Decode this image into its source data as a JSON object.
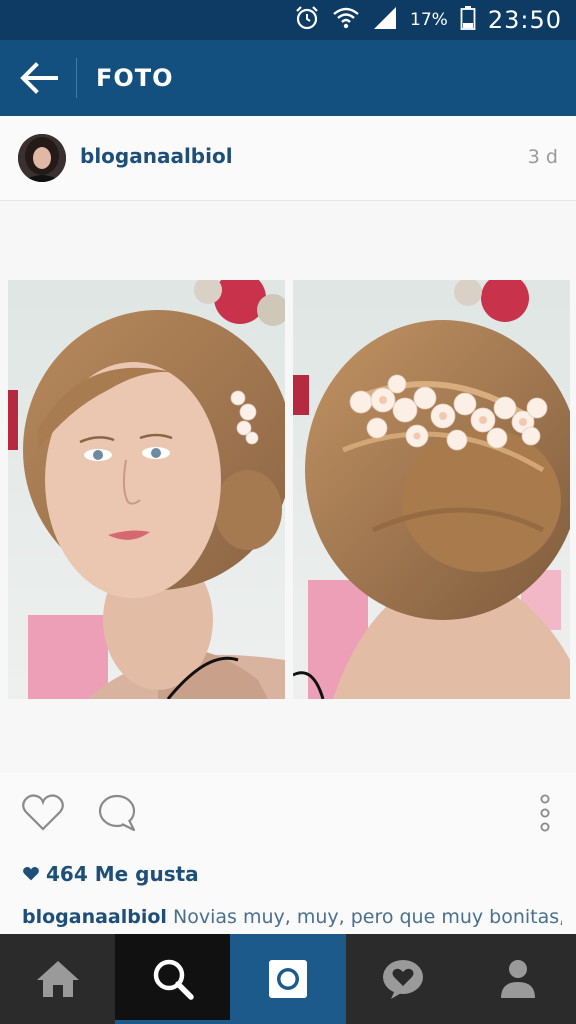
{
  "status_bar": {
    "battery_percent": "17%",
    "time": "23:50",
    "icons": [
      "alarm-icon",
      "wifi-icon",
      "signal-icon",
      "battery-icon"
    ]
  },
  "app_bar": {
    "title": "FOTO",
    "back_icon": "arrow-left-icon"
  },
  "post": {
    "username": "bloganaalbiol",
    "time_ago": "3 d",
    "likes": "464 Me gusta",
    "caption_user": "bloganaalbiol",
    "caption_text": "Novias muy, muy, pero que muy bonitas,"
  },
  "nav": {
    "items": [
      "home-icon",
      "search-icon",
      "camera-icon",
      "activity-heart-icon",
      "profile-icon"
    ],
    "selected": "search-icon"
  },
  "colors": {
    "status_bar": "#0d3b63",
    "app_bar": "#13507f",
    "accent_blue": "#1e4f78",
    "nav_bg": "#2b2b2b",
    "nav_selected": "#1d5a8c"
  }
}
